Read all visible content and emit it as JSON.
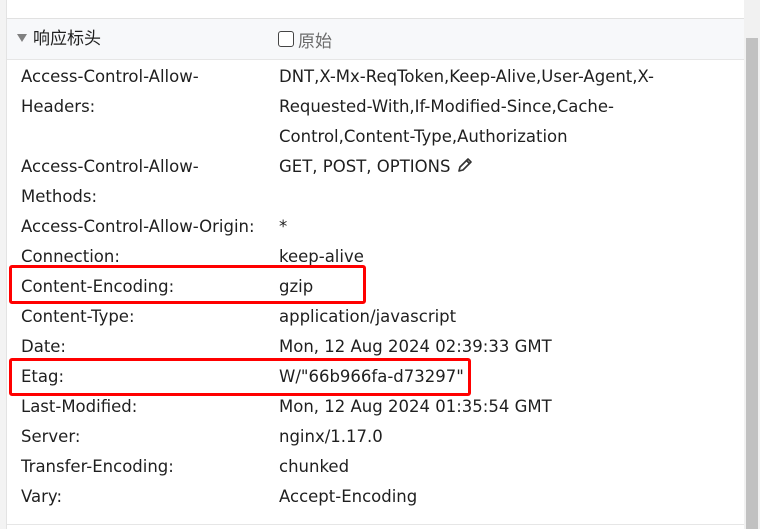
{
  "section": {
    "title": "响应标头",
    "raw_label": "原始"
  },
  "headers": [
    {
      "name": "Access-Control-Allow-Headers",
      "value": "DNT,X-Mx-ReqToken,Keep-Alive,User-Agent,X-Requested-With,If-Modified-Since,Cache-Control,Content-Type,Authorization"
    },
    {
      "name": "Access-Control-Allow-Methods",
      "value": "GET, POST, OPTIONS"
    },
    {
      "name": "Access-Control-Allow-Origin:",
      "value": "*"
    },
    {
      "name": "Connection:",
      "value": "keep-alive"
    },
    {
      "name": "Content-Encoding:",
      "value": "gzip"
    },
    {
      "name": "Content-Type:",
      "value": "application/javascript"
    },
    {
      "name": "Date:",
      "value": "Mon, 12 Aug 2024 02:39:33 GMT"
    },
    {
      "name": "Etag:",
      "value": "W/\"66b966fa-d73297\""
    },
    {
      "name": "Last-Modified:",
      "value": "Mon, 12 Aug 2024 01:35:54 GMT"
    },
    {
      "name": "Server:",
      "value": "nginx/1.17.0"
    },
    {
      "name": "Transfer-Encoding:",
      "value": "chunked"
    },
    {
      "name": "Vary:",
      "value": "Accept-Encoding"
    }
  ],
  "wrapped": {
    "acah_name_1": "Access-Control-Allow-",
    "acah_name_2": "Headers:",
    "acah_val_1": "DNT,X-Mx-ReqToken,Keep-Alive,User-Agent,X-",
    "acah_val_2": "Requested-With,If-Modified-Since,Cache-",
    "acah_val_3": "Control,Content-Type,Authorization",
    "acam_name_1": "Access-Control-Allow-",
    "acam_name_2": "Methods:"
  },
  "highlight_color": "#ff0000",
  "icons": {
    "expand": "triangle-down-icon",
    "edit": "pencil-icon",
    "checkbox": "checkbox-icon"
  }
}
